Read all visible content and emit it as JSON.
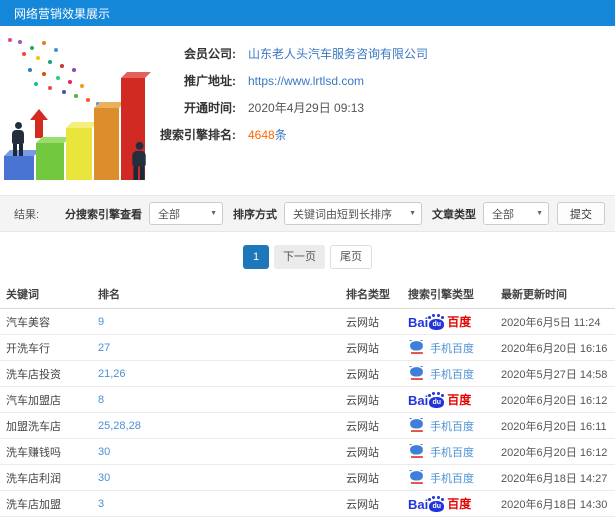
{
  "colors": {
    "header_blue": "#1487d9",
    "link_blue": "#3a78c3",
    "rank_blue": "#4a90d2",
    "highlight_orange": "#ff6600",
    "baidu_blue": "#2334dc",
    "baidu_red": "#e10502",
    "pagination_active": "#1e77b8"
  },
  "header": {
    "title": "网络营销效果展示"
  },
  "info": {
    "fields": [
      {
        "label": "会员公司:",
        "value": "山东老人头汽车服务咨询有限公司",
        "suffix": "",
        "style": "link"
      },
      {
        "label": "推广地址:",
        "value": "https://www.lrtlsd.com",
        "suffix": "",
        "style": "link"
      },
      {
        "label": "开通时间:",
        "value": "2020年4月29日 09:13",
        "suffix": "",
        "style": "plain"
      },
      {
        "label": "搜索引擎排名:",
        "value": "4648",
        "suffix": "条",
        "style": "highlight"
      }
    ]
  },
  "filters": {
    "section_label": "结果:",
    "engine_filter_label": "分搜索引擎查看",
    "engine_filter_value": "全部",
    "sort_label": "排序方式",
    "sort_value": "关键词由短到长排序",
    "article_type_label": "文章类型",
    "article_type_value": "全部",
    "submit_label": "提交"
  },
  "pagination": {
    "current": "1",
    "next_label": "下一页",
    "last_label": "尾页"
  },
  "table": {
    "columns": [
      "关键词",
      "排名",
      "排名类型",
      "搜索引擎类型",
      "最新更新时间"
    ],
    "baidu_logo": {
      "bai": "Bai",
      "du": "du",
      "name": "百度"
    },
    "rows": [
      {
        "keyword": "汽车美容",
        "rank": "9",
        "rank_type": "云网站",
        "engine": "baidu",
        "engine_label": "百度",
        "updated": "2020年6月5日 11:24"
      },
      {
        "keyword": "开洗车行",
        "rank": "27",
        "rank_type": "云网站",
        "engine": "mobile-baidu",
        "engine_label": "手机百度",
        "updated": "2020年6月20日 16:16"
      },
      {
        "keyword": "洗车店投资",
        "rank": "21,26",
        "rank_type": "云网站",
        "engine": "mobile-baidu",
        "engine_label": "手机百度",
        "updated": "2020年5月27日 14:58"
      },
      {
        "keyword": "汽车加盟店",
        "rank": "8",
        "rank_type": "云网站",
        "engine": "baidu",
        "engine_label": "百度",
        "updated": "2020年6月20日 16:12"
      },
      {
        "keyword": "加盟洗车店",
        "rank": "25,28,28",
        "rank_type": "云网站",
        "engine": "mobile-baidu",
        "engine_label": "手机百度",
        "updated": "2020年6月20日 16:11"
      },
      {
        "keyword": "洗车赚钱吗",
        "rank": "30",
        "rank_type": "云网站",
        "engine": "mobile-baidu",
        "engine_label": "手机百度",
        "updated": "2020年6月20日 16:12"
      },
      {
        "keyword": "洗车店利润",
        "rank": "30",
        "rank_type": "云网站",
        "engine": "mobile-baidu",
        "engine_label": "手机百度",
        "updated": "2020年6月18日 14:27"
      },
      {
        "keyword": "洗车店加盟",
        "rank": "3",
        "rank_type": "云网站",
        "engine": "baidu",
        "engine_label": "百度",
        "updated": "2020年6月18日 14:30"
      }
    ]
  }
}
